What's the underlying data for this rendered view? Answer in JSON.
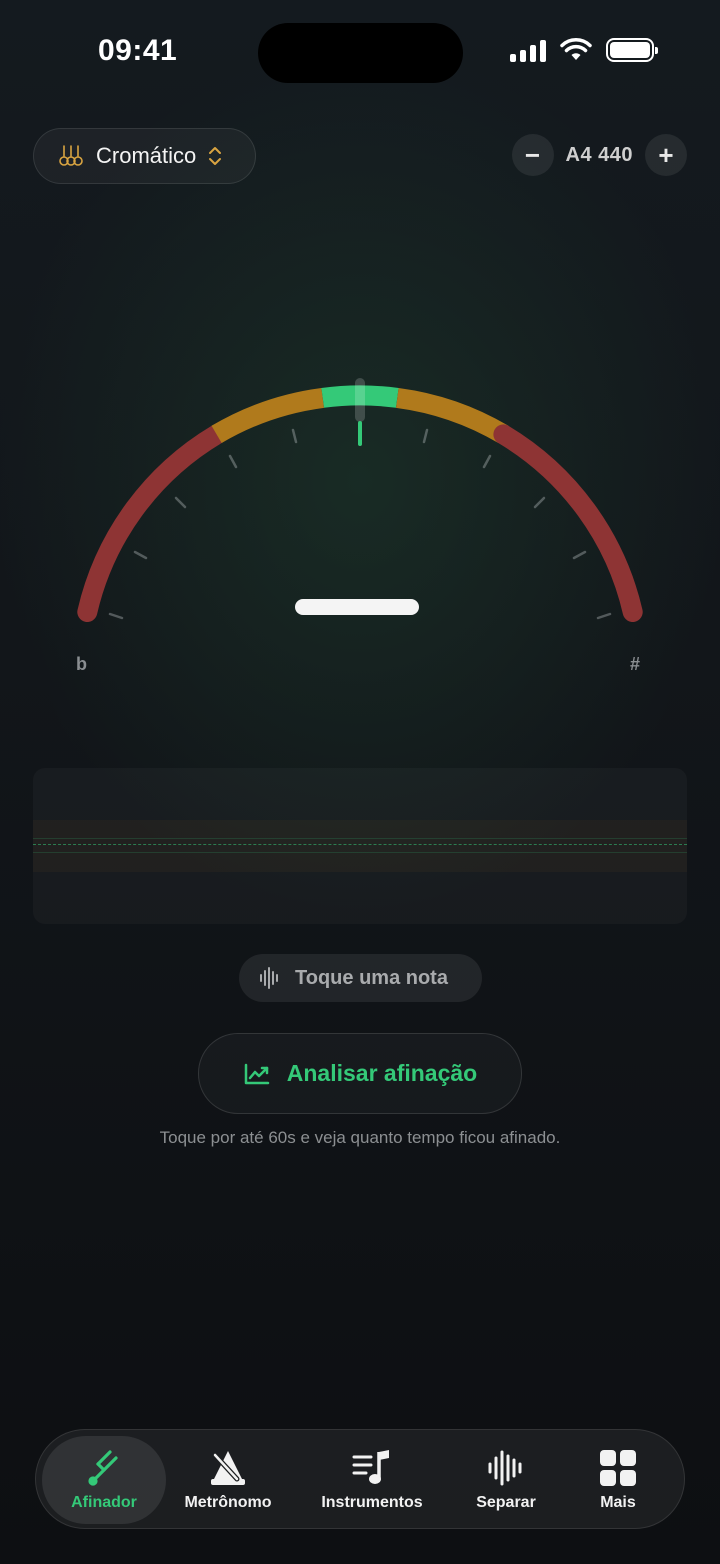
{
  "status_bar": {
    "time": "09:41"
  },
  "mode_selector": {
    "label": "Cromático",
    "icon": "guitars-icon"
  },
  "reference": {
    "label": "A4 440",
    "decrease": "−",
    "increase": "+"
  },
  "gauge": {
    "flat_symbol": "b",
    "sharp_symbol": "#"
  },
  "status_chip": {
    "text": "Toque uma nota",
    "icon": "waveform-icon"
  },
  "analyze": {
    "label": "Analisar afinação",
    "icon": "trend-chart-icon",
    "hint": "Toque por até 60s e veja quanto tempo ficou afinado."
  },
  "colors": {
    "accent": "#34c978",
    "warning": "#b07a1c",
    "danger": "#8e3434"
  },
  "tabs": [
    {
      "label": "Afinador",
      "icon": "tuning-fork-icon",
      "active": true
    },
    {
      "label": "Metrônomo",
      "icon": "metronome-icon",
      "active": false
    },
    {
      "label": "Instrumentos",
      "icon": "music-list-icon",
      "active": false
    },
    {
      "label": "Separar",
      "icon": "waveform-icon",
      "active": false
    },
    {
      "label": "Mais",
      "icon": "grid-icon",
      "active": false
    }
  ]
}
